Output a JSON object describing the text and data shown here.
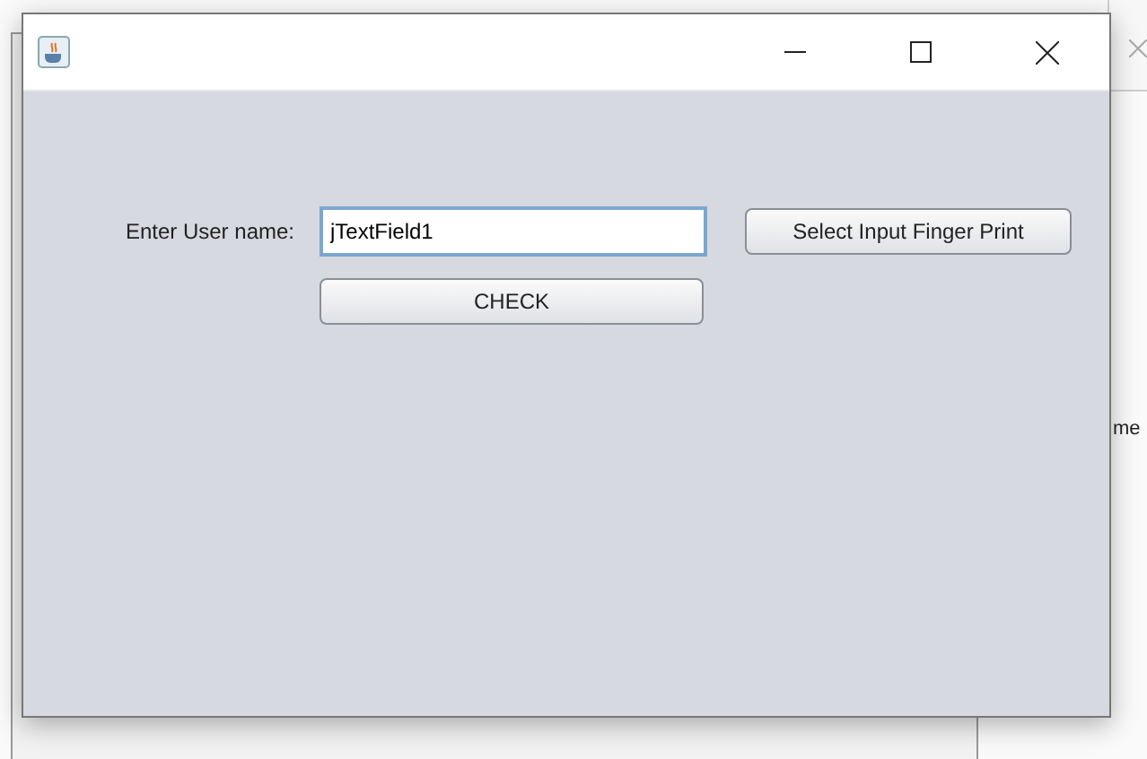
{
  "background_window": {
    "partial_text": "me"
  },
  "window": {
    "controls": [
      {
        "kind": "minimize"
      },
      {
        "kind": "maximize"
      },
      {
        "kind": "close"
      }
    ]
  },
  "form": {
    "label": "Enter User name:",
    "text_field": {
      "value": "jTextField1",
      "focused": true
    },
    "buttons": [
      {
        "label": "Select Input Finger Print"
      },
      {
        "label": "CHECK"
      }
    ]
  }
}
